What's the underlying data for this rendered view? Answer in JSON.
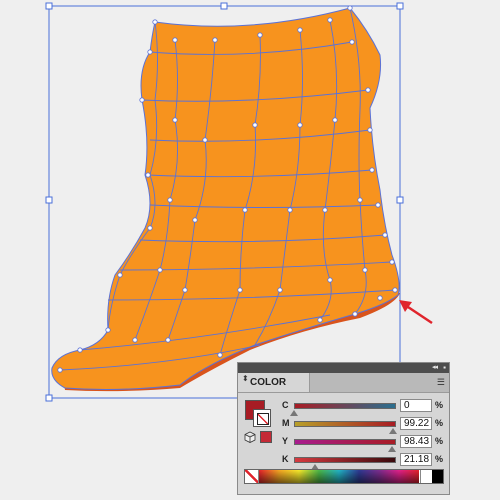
{
  "colors": {
    "fill": "#f7931e",
    "fill_shadow": "#d9541c",
    "mesh_line": "#5b72d6",
    "selection": "#4a6fd8",
    "arrow": "#e0242c",
    "current_fill": "#a81c24"
  },
  "panel": {
    "collapse_icon": "◂◂",
    "close_icon": "▪",
    "tab_arrows_icon": "⬍",
    "title": "COLOR",
    "menu_icon": "☰",
    "rows": [
      {
        "label": "C",
        "value": "0",
        "unit": "%",
        "fraction": 0.0
      },
      {
        "label": "M",
        "value": "99.22",
        "unit": "%",
        "fraction": 0.9922
      },
      {
        "label": "Y",
        "value": "98.43",
        "unit": "%",
        "fraction": 0.9843
      },
      {
        "label": "K",
        "value": "21.18",
        "unit": "%",
        "fraction": 0.2118
      }
    ]
  }
}
